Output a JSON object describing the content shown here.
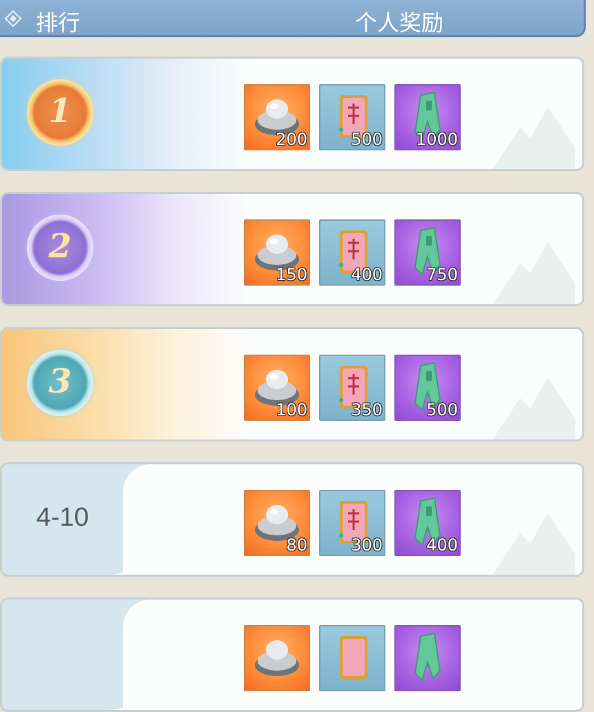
{
  "header": {
    "rank_label": "排行",
    "reward_label": "个人奖励"
  },
  "rows": [
    {
      "rank": "1",
      "rewards": [
        {
          "icon": "silver-ingot-icon",
          "qty": "200"
        },
        {
          "icon": "red-tag-icon",
          "qty": "500"
        },
        {
          "icon": "jade-coin-icon",
          "qty": "1000"
        }
      ]
    },
    {
      "rank": "2",
      "rewards": [
        {
          "icon": "silver-ingot-icon",
          "qty": "150"
        },
        {
          "icon": "red-tag-icon",
          "qty": "400"
        },
        {
          "icon": "jade-coin-icon",
          "qty": "750"
        }
      ]
    },
    {
      "rank": "3",
      "rewards": [
        {
          "icon": "silver-ingot-icon",
          "qty": "100"
        },
        {
          "icon": "red-tag-icon",
          "qty": "350"
        },
        {
          "icon": "jade-coin-icon",
          "qty": "500"
        }
      ]
    },
    {
      "rank": "4-10",
      "rewards": [
        {
          "icon": "silver-ingot-icon",
          "qty": "80"
        },
        {
          "icon": "red-tag-icon",
          "qty": "300"
        },
        {
          "icon": "jade-coin-icon",
          "qty": "400"
        }
      ]
    },
    {
      "rank": "",
      "rewards": [
        {
          "icon": "silver-ingot-icon",
          "qty": ""
        },
        {
          "icon": "red-tag-icon",
          "qty": ""
        },
        {
          "icon": "jade-coin-icon",
          "qty": ""
        }
      ]
    }
  ]
}
